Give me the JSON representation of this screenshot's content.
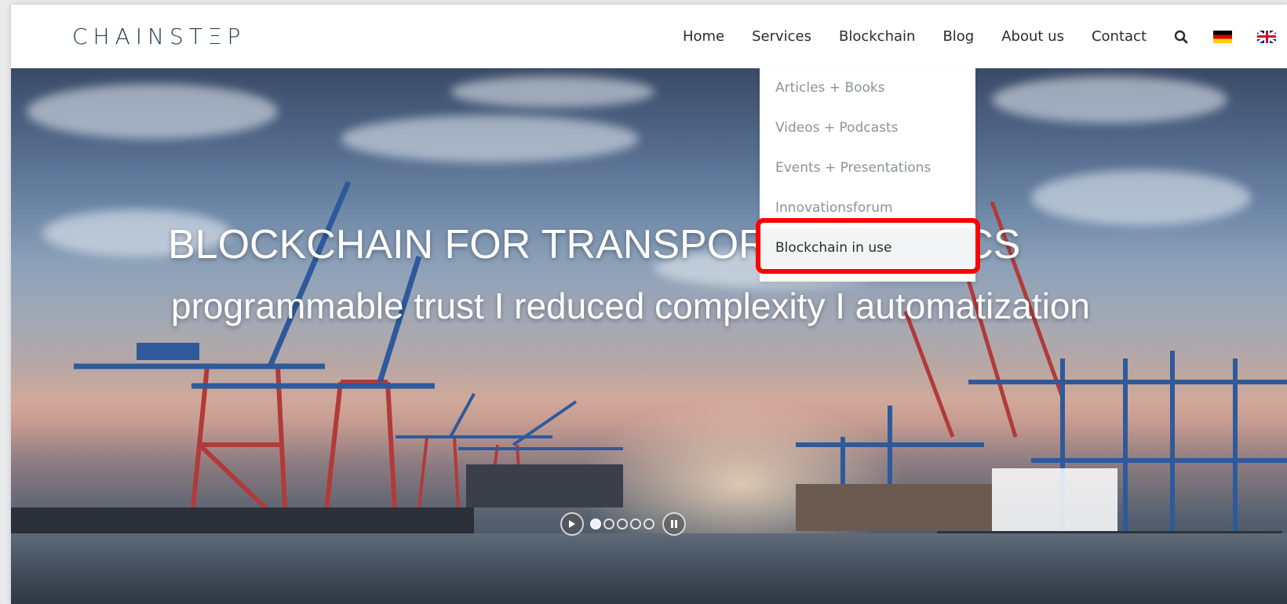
{
  "header": {
    "logo_text": "CHAINSTΞP",
    "nav": [
      {
        "label": "Home"
      },
      {
        "label": "Services"
      },
      {
        "label": "Blockchain"
      },
      {
        "label": "Blog"
      },
      {
        "label": "About us"
      },
      {
        "label": "Contact"
      }
    ],
    "icons": [
      "search-icon",
      "flag-de-icon",
      "flag-uk-icon"
    ]
  },
  "dropdown": {
    "parent": "Blockchain",
    "items": [
      {
        "label": "Articles + Books"
      },
      {
        "label": "Videos + Podcasts"
      },
      {
        "label": "Events + Presentations"
      },
      {
        "label": "Innovationsforum"
      },
      {
        "label": "Blockchain in use"
      }
    ],
    "highlight_color": "#ff0000"
  },
  "hero": {
    "title": "BLOCKCHAIN FOR TRANSPORT LOGISTICS",
    "subtitle": "programmable trust I reduced complexity I automatization",
    "slides_total": 5,
    "slide_active": 1
  },
  "colors": {
    "logo": "#1f3a52",
    "nav_text": "#2b2b2b",
    "dropdown_text": "#8e9297",
    "hero_text": "#ffffff"
  }
}
